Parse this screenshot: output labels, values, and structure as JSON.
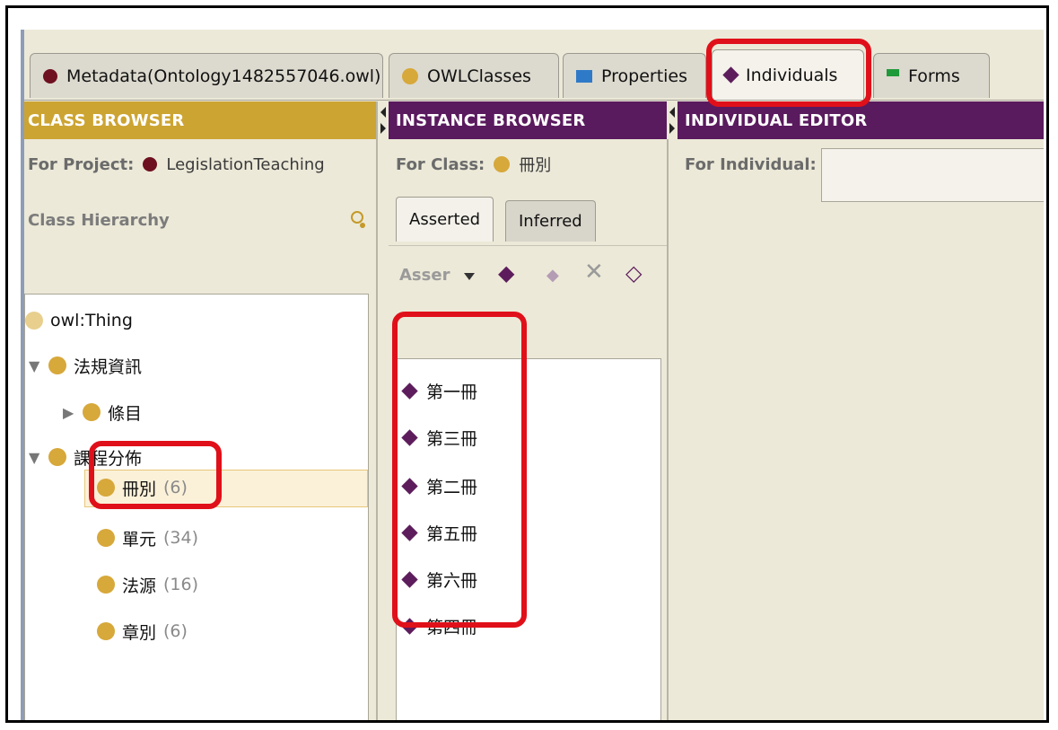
{
  "tabs": [
    {
      "label": "Metadata(Ontology1482557046.owl)",
      "icon": "ontology-icon",
      "color": "#6e1020"
    },
    {
      "label": "OWLClasses",
      "icon": "class-icon",
      "color": "#d7a83a"
    },
    {
      "label": "Properties",
      "icon": "property-icon",
      "color": "#2f7ac8"
    },
    {
      "label": "Individuals",
      "icon": "individual-icon",
      "color": "#5d1d5c"
    },
    {
      "label": "Forms",
      "icon": "forms-icon",
      "color": "#1f9a3a"
    }
  ],
  "class_browser": {
    "title": "CLASS BROWSER",
    "for_label": "For Project:",
    "project_name": "LegislationTeaching",
    "hierarchy_label": "Class Hierarchy",
    "tree": [
      {
        "label": "owl:Thing",
        "count": ""
      },
      {
        "label": "法規資訊",
        "count": ""
      },
      {
        "label": "條目",
        "count": ""
      },
      {
        "label": "課程分佈",
        "count": ""
      },
      {
        "label": "冊別",
        "count": "(6)"
      },
      {
        "label": "單元",
        "count": "(34)"
      },
      {
        "label": "法源",
        "count": "(16)"
      },
      {
        "label": "章別",
        "count": "(6)"
      }
    ]
  },
  "instance_browser": {
    "title": "INSTANCE BROWSER",
    "for_label": "For Class:",
    "class_name": "冊別",
    "tab_asserted": "Asserted",
    "tab_inferred": "Inferred",
    "asser_label": "Asser",
    "instances": [
      "第一冊",
      "第三冊",
      "第二冊",
      "第五冊",
      "第六冊",
      "第四冊"
    ]
  },
  "individual_editor": {
    "title": "INDIVIDUAL EDITOR",
    "for_label": "For Individual:",
    "value": ""
  },
  "colors": {
    "highlight": "#e0101a",
    "gold": "#cca432",
    "purple": "#5a1a5e"
  }
}
